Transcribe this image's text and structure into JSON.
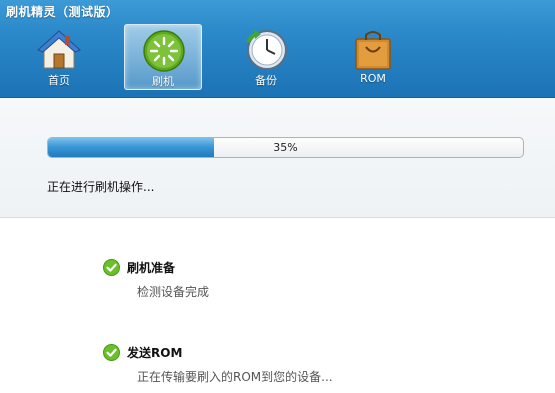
{
  "window": {
    "title": "刷机精灵（测试版）"
  },
  "nav": [
    {
      "label": "首页",
      "icon": "house-icon",
      "active": false
    },
    {
      "label": "刷机",
      "icon": "flash-icon",
      "active": true
    },
    {
      "label": "备份",
      "icon": "backup-clock-icon",
      "active": false
    },
    {
      "label": "ROM",
      "icon": "shopping-bag-icon",
      "active": false
    }
  ],
  "progress": {
    "percent": 35,
    "text": "35%",
    "status": "正在进行刷机操作..."
  },
  "steps": [
    {
      "title": "刷机准备",
      "desc": "检测设备完成",
      "state": "done"
    },
    {
      "title": "发送ROM",
      "desc": "正在传输要刷入的ROM到您的设备...",
      "state": "done"
    }
  ],
  "colors": {
    "accent": "#1b73b5",
    "progress": "#3c97d6",
    "check": "#6bbf2a"
  }
}
